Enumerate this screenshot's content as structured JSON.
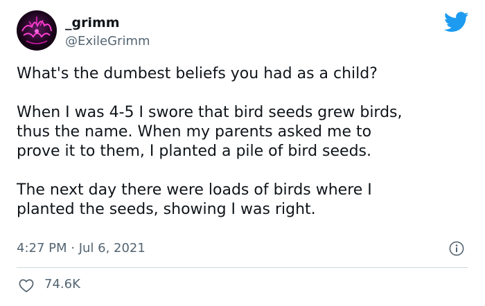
{
  "author": {
    "display_name": "_grimm",
    "handle": "@ExileGrimm",
    "avatar_icon": "avatar-image"
  },
  "tweet": {
    "paragraphs": [
      "What's the dumbest beliefs you had as a child?",
      "When I was 4-5 I swore that bird seeds grew birds,\nthus the name. When my parents asked me to\nprove it to them, I planted a pile of bird seeds.",
      "The next day there were loads of birds where I\nplanted the seeds, showing I was right."
    ],
    "timestamp": "4:27 PM · Jul 6, 2021"
  },
  "actions": {
    "like_count": "74.6K",
    "like_icon": "heart-icon",
    "info_icon": "info-icon"
  },
  "brand": {
    "logo_icon": "twitter-bird-icon",
    "accent_color": "#1d9bf0"
  }
}
